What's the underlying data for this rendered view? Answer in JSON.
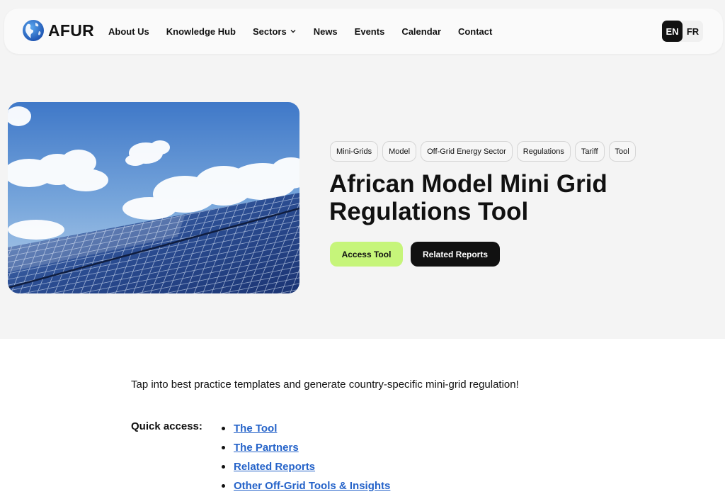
{
  "brand": {
    "name": "AFUR",
    "logo_icon": "globe-icon"
  },
  "nav": {
    "items": [
      {
        "label": "About Us"
      },
      {
        "label": "Knowledge Hub"
      },
      {
        "label": "Sectors",
        "has_dropdown": true
      },
      {
        "label": "News"
      },
      {
        "label": "Events"
      },
      {
        "label": "Calendar"
      },
      {
        "label": "Contact"
      }
    ]
  },
  "language": {
    "options": [
      "EN",
      "FR"
    ],
    "selected": "EN"
  },
  "hero": {
    "tags": [
      "Mini-Grids",
      "Model",
      "Off-Grid Energy Sector",
      "Regulations",
      "Tariff",
      "Tool"
    ],
    "title": "African Model Mini Grid Regulations Tool",
    "primary_button": "Access Tool",
    "secondary_button": "Related Reports"
  },
  "content": {
    "intro": "Tap into best practice templates and generate country-specific mini-grid regulation!",
    "quick_access_label": "Quick access:",
    "quick_links": [
      "The Tool",
      "The Partners",
      "Related Reports",
      "Other Off-Grid Tools & Insights"
    ]
  },
  "colors": {
    "accent_green": "#c6f57a",
    "dark": "#111111",
    "link_blue": "#2563c9"
  }
}
